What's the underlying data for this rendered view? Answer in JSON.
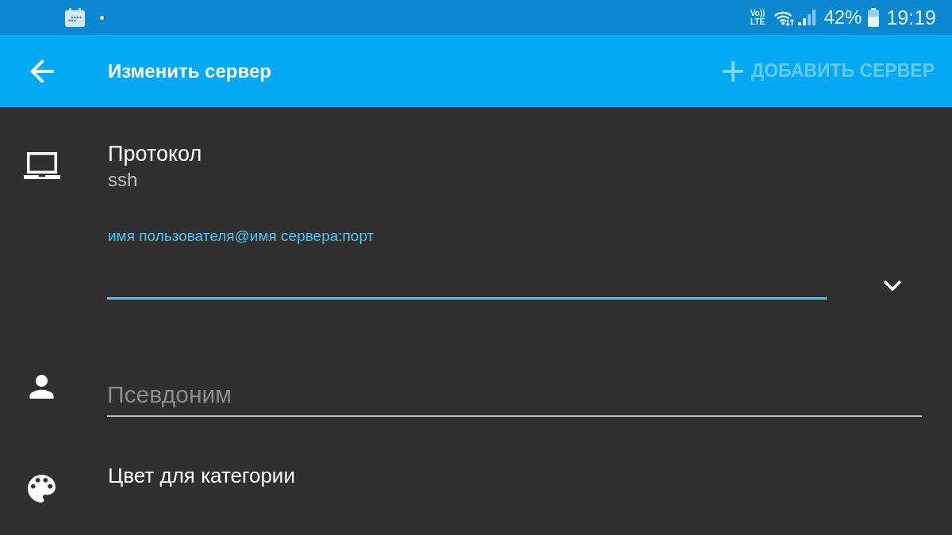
{
  "status_bar": {
    "network_label": [
      "Vo))",
      "LTE"
    ],
    "battery": "42%",
    "time": "19:19"
  },
  "app_bar": {
    "title": "Изменить сервер",
    "action": {
      "label": "ДОБАВИТЬ СЕРВЕР",
      "disabled": true
    }
  },
  "form": {
    "protocol": {
      "label": "Протокол",
      "value": "ssh"
    },
    "address": {
      "label": "имя пользователя@имя сервера:порт",
      "focused": true
    },
    "alias": {
      "placeholder": "Псевдоним",
      "focused": false
    },
    "category_color": {
      "label": "Цвет для категории"
    }
  }
}
